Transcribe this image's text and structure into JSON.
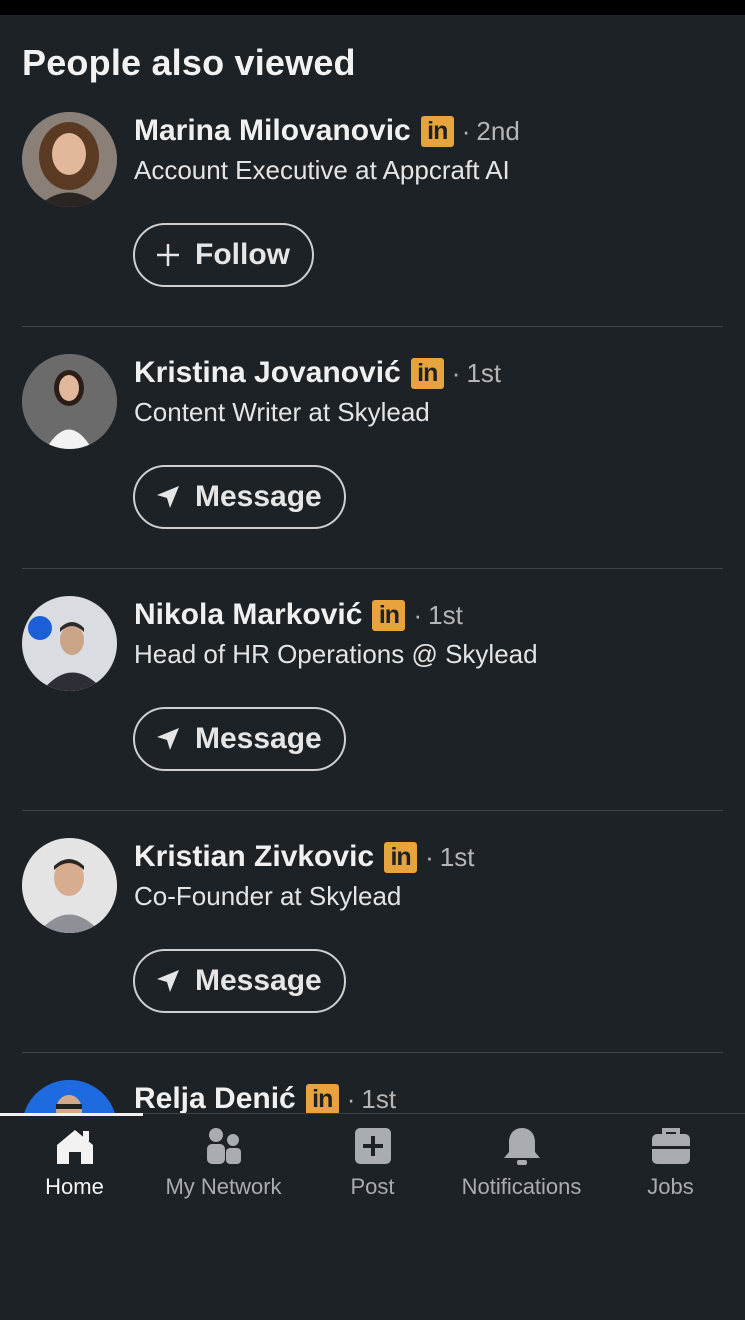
{
  "section": {
    "title": "People also viewed"
  },
  "people": [
    {
      "name": "Marina Milovanovic",
      "badge": "in",
      "separator": "·",
      "degree": "2nd",
      "headline": "Account Executive at Appcraft AI",
      "action": "Follow",
      "action_icon": "plus-icon"
    },
    {
      "name": "Kristina Jovanović",
      "badge": "in",
      "separator": "·",
      "degree": "1st",
      "headline": "Content Writer at Skylead",
      "action": "Message",
      "action_icon": "send-icon"
    },
    {
      "name": "Nikola Marković",
      "badge": "in",
      "separator": "·",
      "degree": "1st",
      "headline": "Head of HR Operations @ Skylead",
      "action": "Message",
      "action_icon": "send-icon"
    },
    {
      "name": "Kristian Zivkovic",
      "badge": "in",
      "separator": "·",
      "degree": "1st",
      "headline": "Co-Founder at Skylead",
      "action": "Message",
      "action_icon": "send-icon"
    },
    {
      "name": "Relja Denić",
      "badge": "in",
      "separator": "·",
      "degree": "1st",
      "headline": "",
      "action": "",
      "action_icon": ""
    }
  ],
  "tabs": [
    {
      "label": "Home",
      "icon": "home-icon",
      "active": true
    },
    {
      "label": "My Network",
      "icon": "network-icon",
      "active": false
    },
    {
      "label": "Post",
      "icon": "post-icon",
      "active": false
    },
    {
      "label": "Notifications",
      "icon": "bell-icon",
      "active": false
    },
    {
      "label": "Jobs",
      "icon": "briefcase-icon",
      "active": false
    }
  ],
  "colors": {
    "background": "#1d2226",
    "badge": "#e7a33e",
    "divider": "#3d4349"
  }
}
